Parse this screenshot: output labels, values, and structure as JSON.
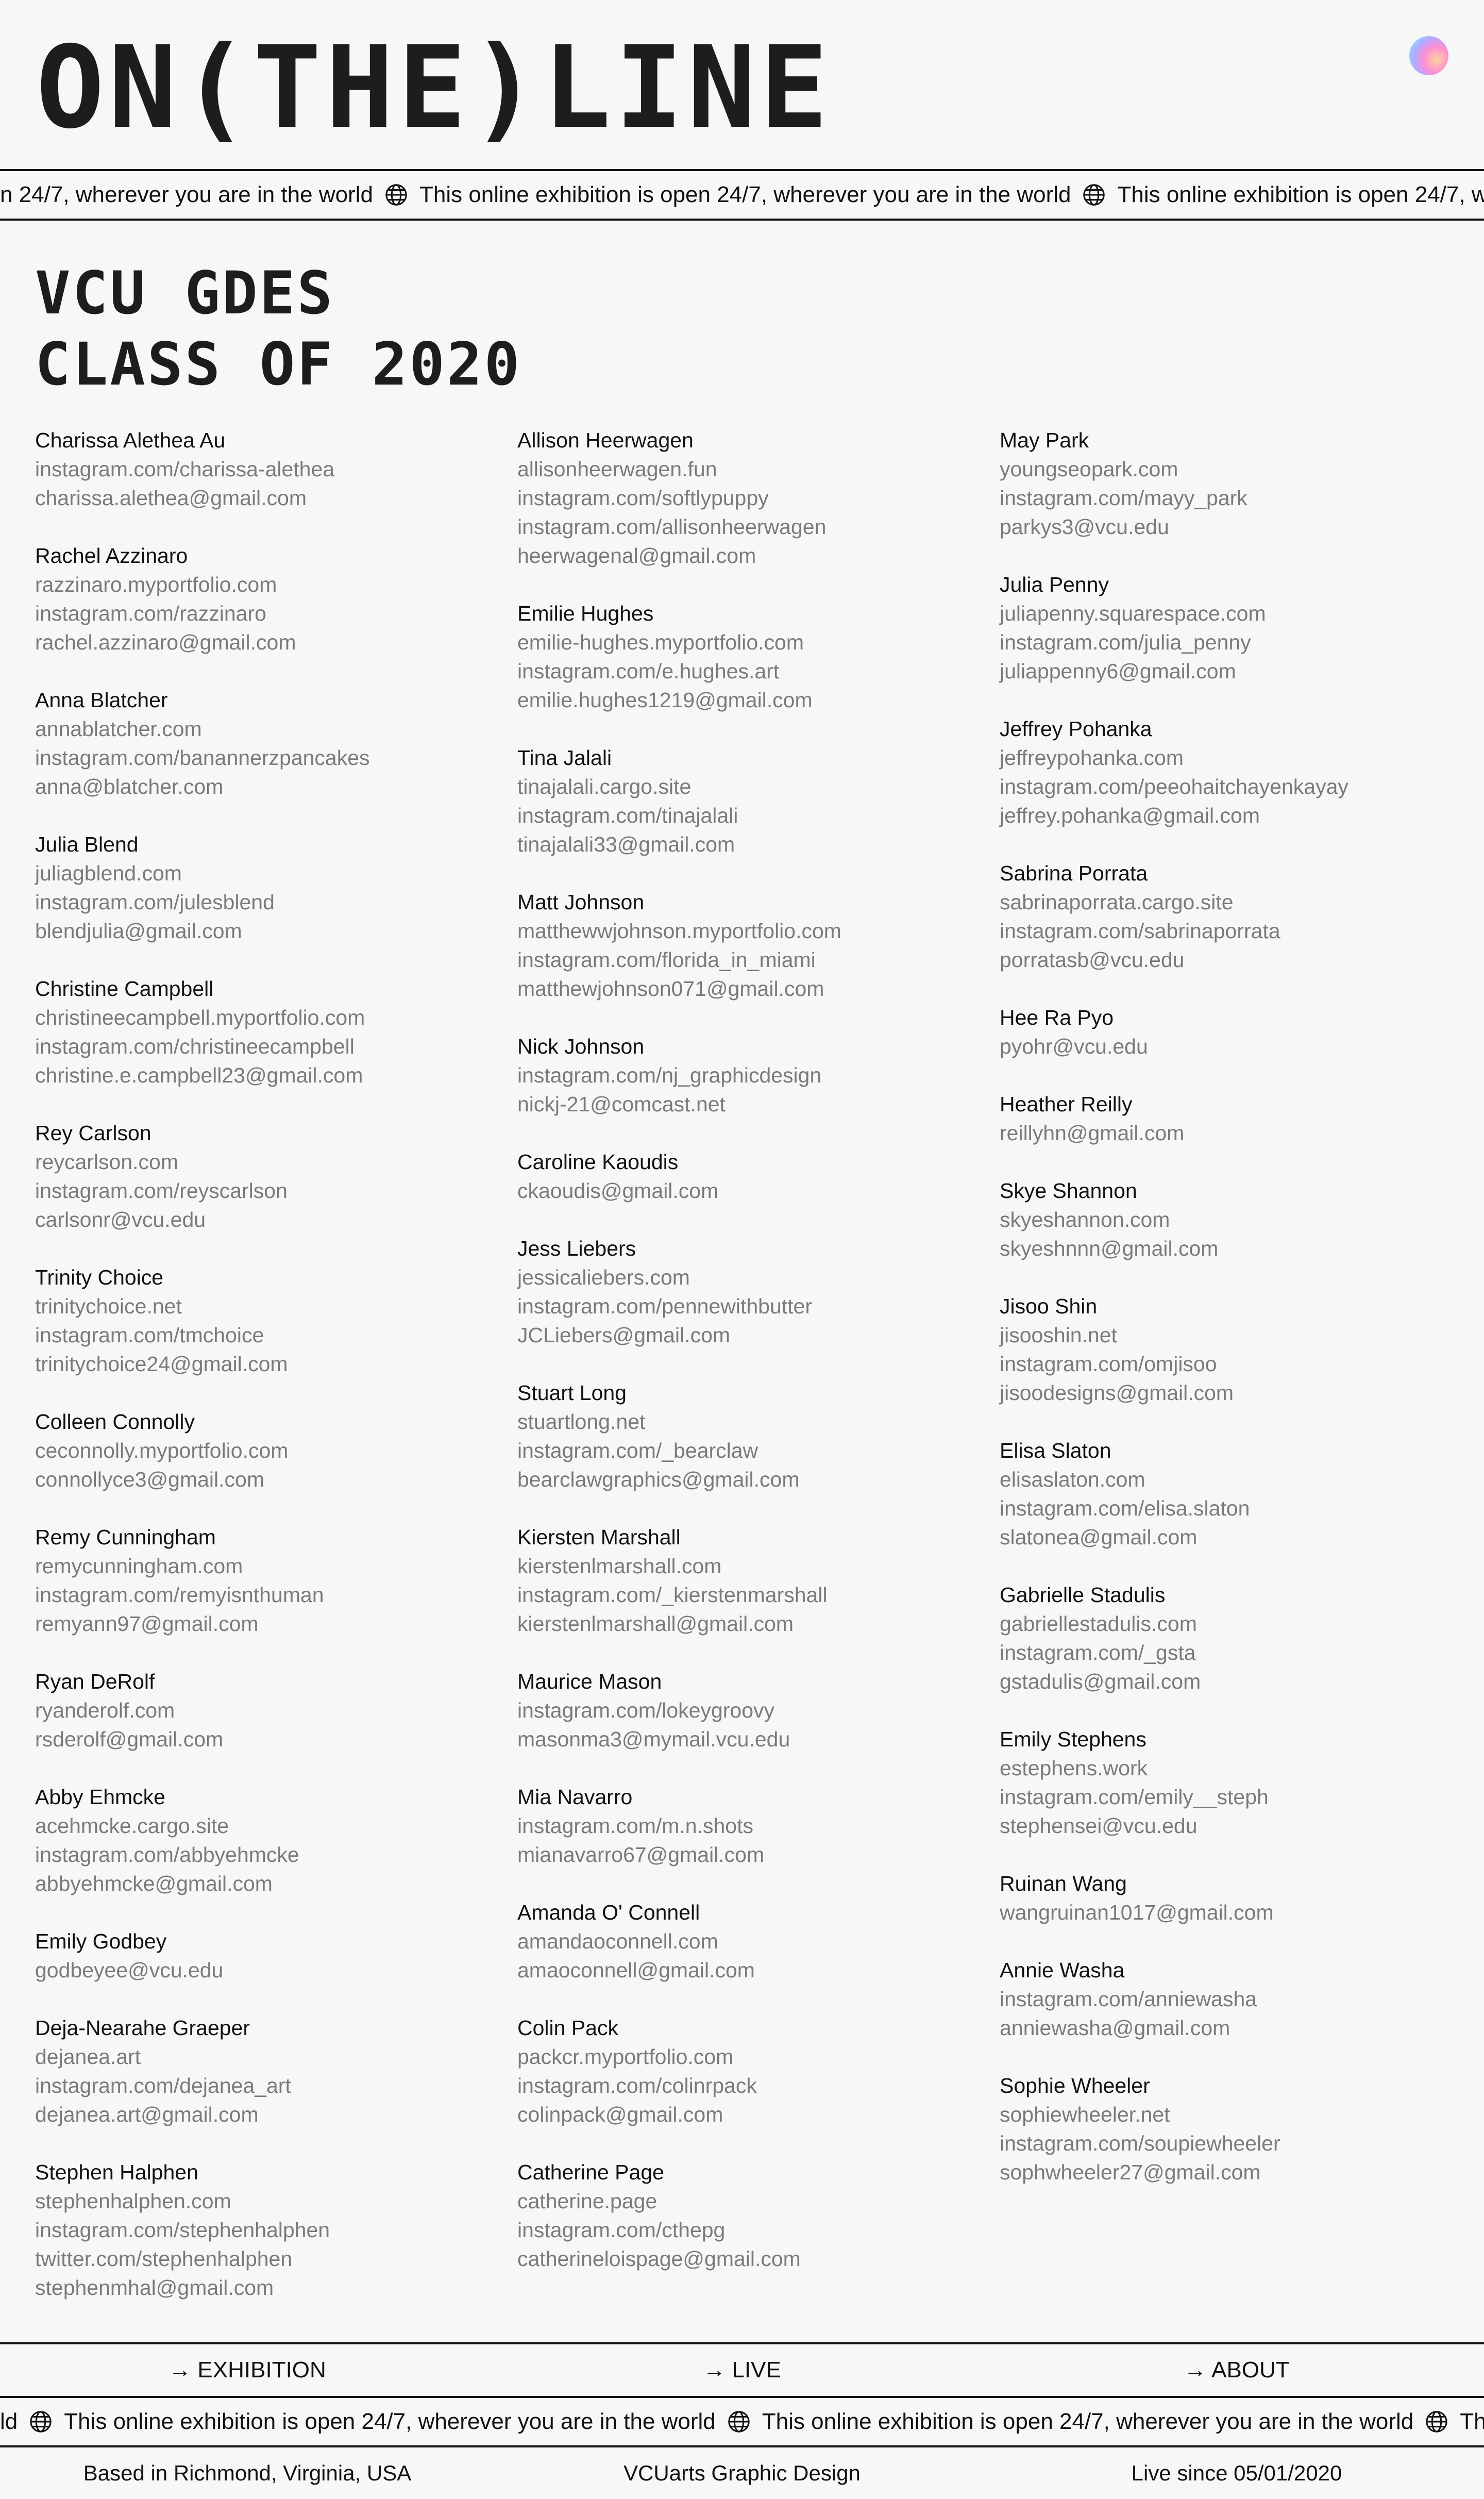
{
  "header": {
    "logo": "ON(THE)LINE"
  },
  "ticker": {
    "top_lead": "n 24/7, wherever you are in the world",
    "bottom_lead": "ld",
    "message": "This online exhibition is open 24/7, wherever you are in the world"
  },
  "title": {
    "line1": "VCU GDES",
    "line2": "CLASS OF 2020"
  },
  "columns": [
    [
      {
        "name": "Charissa Alethea Au",
        "links": [
          "instagram.com/charissa-alethea",
          "charissa.alethea@gmail.com"
        ]
      },
      {
        "name": "Rachel Azzinaro",
        "links": [
          "razzinaro.myportfolio.com",
          "instagram.com/razzinaro",
          "rachel.azzinaro@gmail.com"
        ]
      },
      {
        "name": "Anna Blatcher",
        "links": [
          "annablatcher.com",
          "instagram.com/banannerzpancakes",
          "anna@blatcher.com"
        ]
      },
      {
        "name": "Julia Blend",
        "links": [
          "juliagblend.com",
          "instagram.com/julesblend",
          "blendjulia@gmail.com"
        ]
      },
      {
        "name": "Christine Campbell",
        "links": [
          "christineecampbell.myportfolio.com",
          "instagram.com/christineecampbell",
          "christine.e.campbell23@gmail.com"
        ]
      },
      {
        "name": "Rey Carlson",
        "links": [
          "reycarlson.com",
          "instagram.com/reyscarlson",
          "carlsonr@vcu.edu"
        ]
      },
      {
        "name": "Trinity Choice",
        "links": [
          "trinitychoice.net",
          "instagram.com/tmchoice",
          "trinitychoice24@gmail.com"
        ]
      },
      {
        "name": "Colleen Connolly",
        "links": [
          "ceconnolly.myportfolio.com",
          "connollyce3@gmail.com"
        ]
      },
      {
        "name": "Remy Cunningham",
        "links": [
          "remycunningham.com",
          "instagram.com/remyisnthuman",
          "remyann97@gmail.com"
        ]
      },
      {
        "name": "Ryan DeRolf",
        "links": [
          "ryanderolf.com",
          "rsderolf@gmail.com"
        ]
      },
      {
        "name": "Abby Ehmcke",
        "links": [
          "acehmcke.cargo.site",
          "instagram.com/abbyehmcke",
          "abbyehmcke@gmail.com"
        ]
      },
      {
        "name": "Emily Godbey",
        "links": [
          "godbeyee@vcu.edu"
        ]
      },
      {
        "name": "Deja-Nearahe Graeper",
        "links": [
          "dejanea.art",
          "instagram.com/dejanea_art",
          "dejanea.art@gmail.com"
        ]
      },
      {
        "name": "Stephen Halphen",
        "links": [
          "stephenhalphen.com",
          "instagram.com/stephenhalphen",
          "twitter.com/stephenhalphen",
          "stephenmhal@gmail.com"
        ]
      }
    ],
    [
      {
        "name": "Allison Heerwagen",
        "links": [
          "allisonheerwagen.fun",
          "instagram.com/softlypuppy",
          "instagram.com/allisonheerwagen",
          "heerwagenal@gmail.com"
        ]
      },
      {
        "name": "Emilie Hughes",
        "links": [
          "emilie-hughes.myportfolio.com",
          "instagram.com/e.hughes.art",
          "emilie.hughes1219@gmail.com"
        ]
      },
      {
        "name": "Tina Jalali",
        "links": [
          "tinajalali.cargo.site",
          "instagram.com/tinajalali",
          "tinajalali33@gmail.com"
        ]
      },
      {
        "name": "Matt Johnson",
        "links": [
          "matthewwjohnson.myportfolio.com",
          "instagram.com/florida_in_miami",
          "matthewjohnson071@gmail.com"
        ]
      },
      {
        "name": "Nick Johnson",
        "links": [
          "instagram.com/nj_graphicdesign",
          "nickj-21@comcast.net"
        ]
      },
      {
        "name": "Caroline Kaoudis",
        "links": [
          "ckaoudis@gmail.com"
        ]
      },
      {
        "name": "Jess Liebers",
        "links": [
          "jessicaliebers.com",
          "instagram.com/pennewithbutter",
          "JCLiebers@gmail.com"
        ]
      },
      {
        "name": "Stuart Long",
        "links": [
          "stuartlong.net",
          "instagram.com/_bearclaw",
          "bearclawgraphics@gmail.com"
        ]
      },
      {
        "name": "Kiersten Marshall",
        "links": [
          "kierstenlmarshall.com",
          "instagram.com/_kierstenmarshall",
          "kierstenlmarshall@gmail.com"
        ]
      },
      {
        "name": "Maurice Mason",
        "links": [
          "instagram.com/lokeygroovy",
          "masonma3@mymail.vcu.edu"
        ]
      },
      {
        "name": "Mia Navarro",
        "links": [
          "instagram.com/m.n.shots",
          "mianavarro67@gmail.com"
        ]
      },
      {
        "name": "Amanda O' Connell",
        "links": [
          "amandaoconnell.com",
          "amaoconnell@gmail.com"
        ]
      },
      {
        "name": "Colin Pack",
        "links": [
          "packcr.myportfolio.com",
          "instagram.com/colinrpack",
          "colinpack@gmail.com"
        ]
      },
      {
        "name": "Catherine Page",
        "links": [
          "catherine.page",
          "instagram.com/cthepg",
          "catherineloispage@gmail.com"
        ]
      }
    ],
    [
      {
        "name": "May Park",
        "links": [
          "youngseopark.com",
          "instagram.com/mayy_park",
          "parkys3@vcu.edu"
        ]
      },
      {
        "name": "Julia Penny",
        "links": [
          "juliapenny.squarespace.com",
          "instagram.com/julia_penny",
          "juliappenny6@gmail.com"
        ]
      },
      {
        "name": "Jeffrey Pohanka",
        "links": [
          "jeffreypohanka.com",
          "instagram.com/peeohaitchayenkayay",
          "jeffrey.pohanka@gmail.com"
        ]
      },
      {
        "name": "Sabrina Porrata",
        "links": [
          "sabrinaporrata.cargo.site",
          "instagram.com/sabrinaporrata",
          "porratasb@vcu.edu"
        ]
      },
      {
        "name": "Hee Ra Pyo",
        "links": [
          "pyohr@vcu.edu"
        ]
      },
      {
        "name": "Heather Reilly",
        "links": [
          "reillyhn@gmail.com"
        ]
      },
      {
        "name": "Skye Shannon",
        "links": [
          "skyeshannon.com",
          "skyeshnnn@gmail.com"
        ]
      },
      {
        "name": "Jisoo Shin",
        "links": [
          "jisooshin.net",
          "instagram.com/omjisoo",
          "jisoodesigns@gmail.com"
        ]
      },
      {
        "name": "Elisa Slaton",
        "links": [
          "elisaslaton.com",
          "instagram.com/elisa.slaton",
          "slatonea@gmail.com"
        ]
      },
      {
        "name": "Gabrielle Stadulis",
        "links": [
          "gabriellestadulis.com",
          "instagram.com/_gsta",
          "gstadulis@gmail.com"
        ]
      },
      {
        "name": "Emily Stephens",
        "links": [
          "estephens.work",
          "instagram.com/emily__steph",
          "stephensei@vcu.edu"
        ]
      },
      {
        "name": "Ruinan Wang",
        "links": [
          "wangruinan1017@gmail.com"
        ]
      },
      {
        "name": "Annie Washa",
        "links": [
          "instagram.com/anniewasha",
          "anniewasha@gmail.com"
        ]
      },
      {
        "name": "Sophie Wheeler",
        "links": [
          "sophiewheeler.net",
          "instagram.com/soupiewheeler",
          "sophwheeler27@gmail.com"
        ]
      }
    ]
  ],
  "nav": {
    "exhibition": "→ EXHIBITION",
    "live": "→ LIVE",
    "about": "→ ABOUT"
  },
  "footer": {
    "location": "Based in Richmond, Virginia, USA",
    "org": "VCUarts Graphic Design",
    "since": "Live since 05/01/2020"
  }
}
